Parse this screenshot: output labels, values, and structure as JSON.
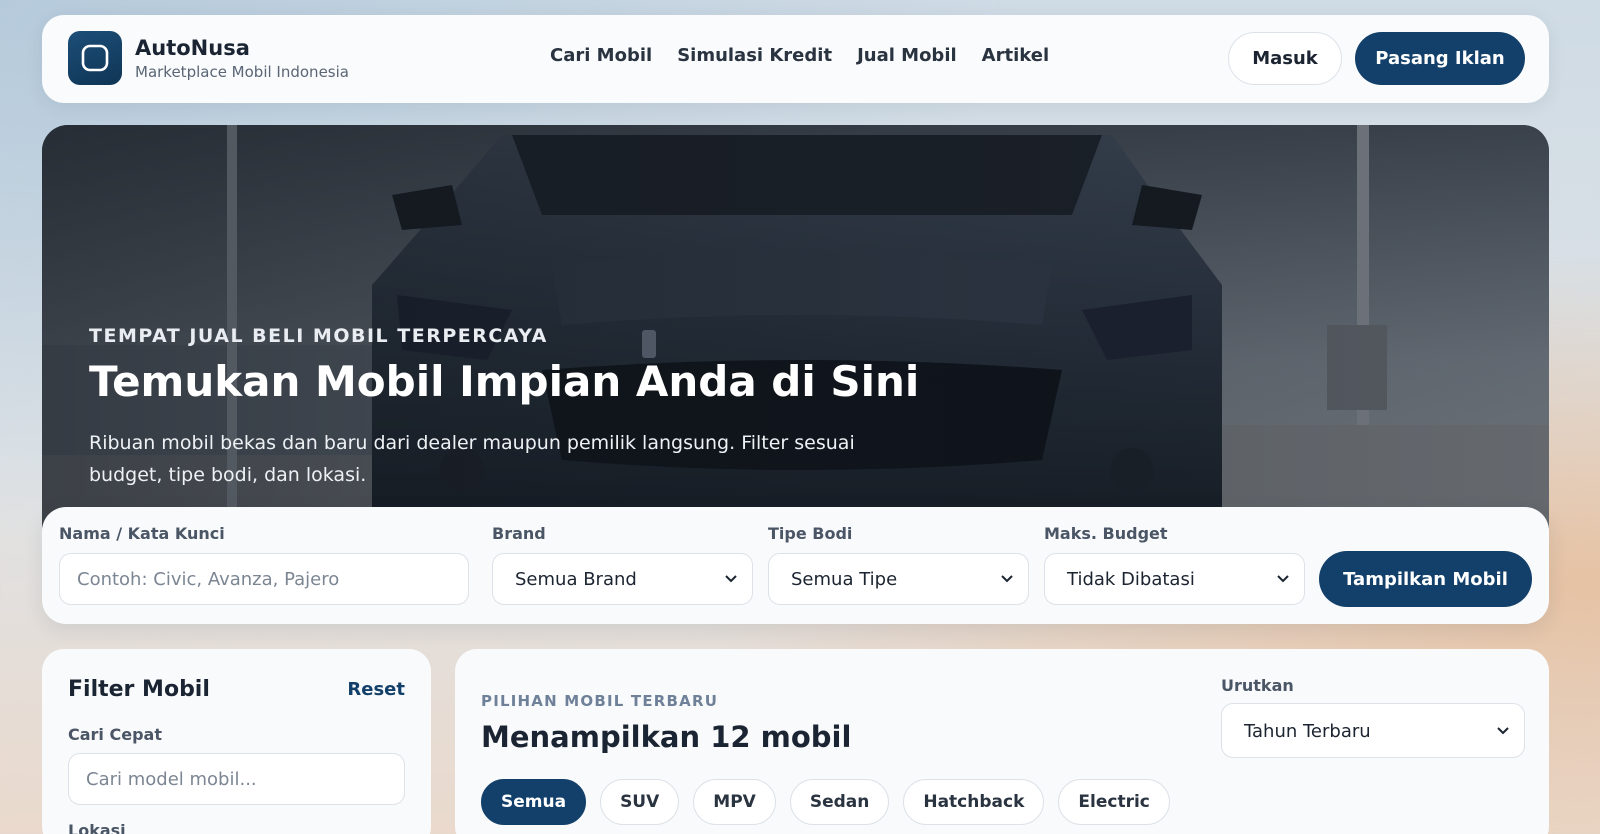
{
  "header": {
    "brand_name": "AutoNusa",
    "brand_tagline": "Marketplace Mobil Indonesia",
    "nav": [
      "Cari Mobil",
      "Simulasi Kredit",
      "Jual Mobil",
      "Artikel"
    ],
    "login_label": "Masuk",
    "post_ad_label": "Pasang Iklan"
  },
  "hero": {
    "eyebrow": "TEMPAT JUAL BELI MOBIL TERPERCAYA",
    "title": "Temukan Mobil Impian Anda di Sini",
    "description": "Ribuan mobil bekas dan baru dari dealer maupun pemilik langsung. Filter sesuai budget, tipe bodi, dan lokasi."
  },
  "search": {
    "keyword_label": "Nama / Kata Kunci",
    "keyword_placeholder": "Contoh: Civic, Avanza, Pajero",
    "keyword_value": "",
    "brand_label": "Brand",
    "brand_value": "Semua Brand",
    "body_label": "Tipe Bodi",
    "body_value": "Semua Tipe",
    "budget_label": "Maks. Budget",
    "budget_value": "Tidak Dibatasi",
    "submit_label": "Tampilkan Mobil"
  },
  "filter": {
    "title": "Filter Mobil",
    "reset_label": "Reset",
    "quick_search_label": "Cari Cepat",
    "quick_search_placeholder": "Cari model mobil...",
    "location_label": "Lokasi"
  },
  "results": {
    "eyebrow": "PILIHAN MOBIL TERBARU",
    "title": "Menampilkan 12 mobil",
    "sort_label": "Urutkan",
    "sort_value": "Tahun Terbaru",
    "chips": [
      "Semua",
      "SUV",
      "MPV",
      "Sedan",
      "Hatchback",
      "Electric"
    ],
    "active_chip": "Semua"
  },
  "colors": {
    "primary": "#13406a",
    "surface": "#f9fafb",
    "text": "#1b2430"
  }
}
